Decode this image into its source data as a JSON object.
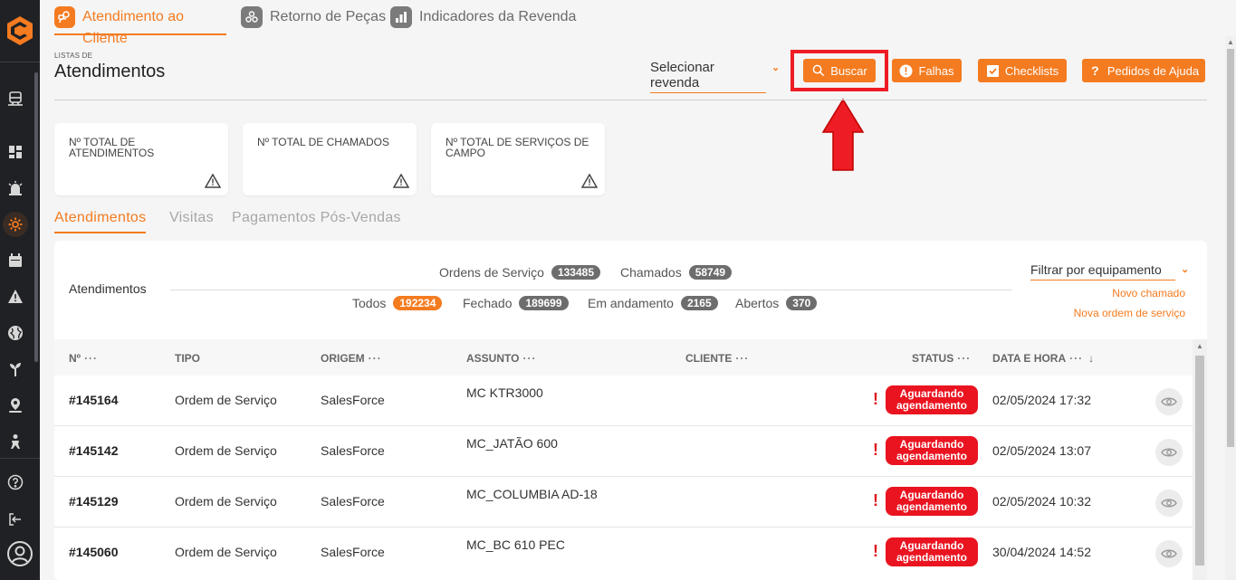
{
  "sidebar": {
    "icons": [
      "logo-icon",
      "train-icon",
      "dashboard-icon",
      "alarm-icon",
      "gear-wrench-icon",
      "calendar-icon",
      "warning-icon",
      "globe-icon",
      "plant-icon",
      "location-icon",
      "person-icon",
      "help-icon",
      "logout-icon",
      "user-icon"
    ],
    "active": "gear-wrench-icon"
  },
  "tabs": [
    {
      "label": "Atendimento ao Cliente",
      "icon": "support-icon",
      "active": true
    },
    {
      "label": "Retorno de Peças",
      "icon": "parts-icon",
      "active": false
    },
    {
      "label": "Indicadores da Revenda",
      "icon": "bar-chart-icon",
      "active": false
    }
  ],
  "header": {
    "small_title": "LISTAS DE",
    "title": "Atendimentos",
    "select_revenda": "Selecionar revenda",
    "buttons": {
      "buscar": "Buscar",
      "falhas": "Falhas",
      "checklists": "Checklists",
      "ajuda": "Pedidos de Ajuda"
    }
  },
  "cards": [
    {
      "label": "Nº TOTAL DE ATENDIMENTOS"
    },
    {
      "label": "Nº TOTAL DE CHAMADOS"
    },
    {
      "label": "Nº TOTAL DE SERVIÇOS DE CAMPO"
    }
  ],
  "subtabs": [
    "Atendimentos",
    "Visitas",
    "Pagamentos Pós-Vendas"
  ],
  "panel": {
    "title": "Atendimentos",
    "stats": {
      "ordens_label": "Ordens de Serviço",
      "ordens_count": "133485",
      "chamados_label": "Chamados",
      "chamados_count": "58749",
      "todos_label": "Todos",
      "todos_count": "192234",
      "fechado_label": "Fechado",
      "fechado_count": "189699",
      "andamento_label": "Em andamento",
      "andamento_count": "2165",
      "abertos_label": "Abertos",
      "abertos_count": "370"
    },
    "filter": "Filtrar por equipamento",
    "links": {
      "novo_chamado": "Novo chamado",
      "nova_ordem": "Nova ordem de serviço"
    }
  },
  "table": {
    "headers": {
      "num": "Nº",
      "tipo": "TIPO",
      "origem": "ORIGEM",
      "assunto": "ASSUNTO",
      "cliente": "CLIENTE",
      "status": "STATUS",
      "data": "DATA E HORA"
    },
    "rows": [
      {
        "num": "#145164",
        "tipo": "Ordem de Serviço",
        "origem": "SalesForce",
        "assunto": "MC  KTR3000",
        "status_line1": "Aguardando",
        "status_line2": "agendamento",
        "data": "02/05/2024 17:32"
      },
      {
        "num": "#145142",
        "tipo": "Ordem de Serviço",
        "origem": "SalesForce",
        "assunto": "MC_JATÃO 600",
        "status_line1": "Aguardando",
        "status_line2": "agendamento",
        "data": "02/05/2024 13:07"
      },
      {
        "num": "#145129",
        "tipo": "Ordem de Serviço",
        "origem": "SalesForce",
        "assunto": "MC_COLUMBIA AD-18",
        "status_line1": "Aguardando",
        "status_line2": "agendamento",
        "data": "02/05/2024 10:32"
      },
      {
        "num": "#145060",
        "tipo": "Ordem de Serviço",
        "origem": "SalesForce",
        "assunto": "MC_BC 610 PEC",
        "status_line1": "Aguardando",
        "status_line2": "agendamento",
        "data": "30/04/2024 14:52"
      }
    ]
  },
  "colors": {
    "accent": "#f47b20",
    "status_red": "#ea1420",
    "highlight": "#ee1c24",
    "sidebar_bg": "#1f2124"
  }
}
